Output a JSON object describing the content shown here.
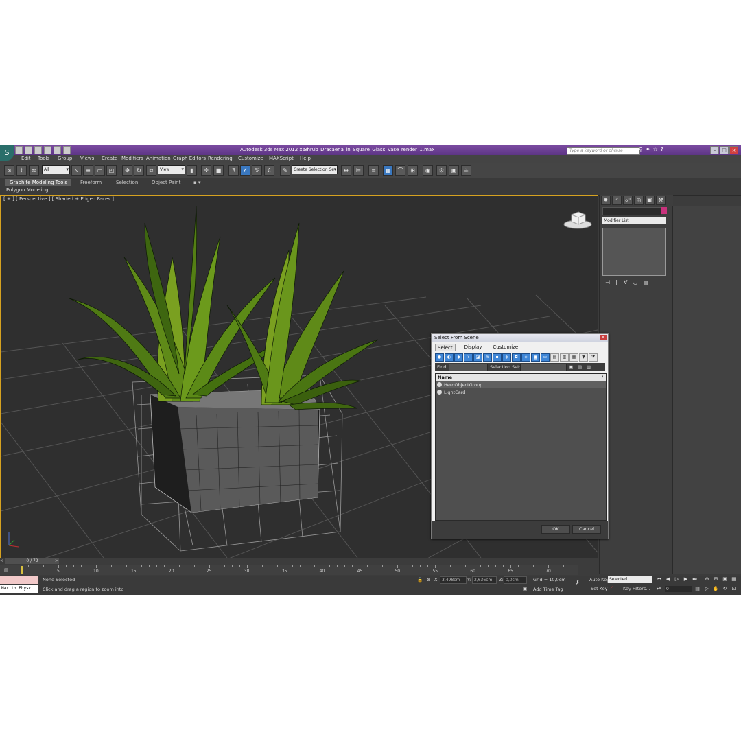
{
  "window": {
    "app_title": "Autodesk 3ds Max  2012 x64",
    "file_title": "Shrub_Dracaena_in_Square_Glass_Vase_render_1.max",
    "search_placeholder": "Type a keyword or phrase"
  },
  "menu": [
    "Edit",
    "Tools",
    "Group",
    "Views",
    "Create",
    "Modifiers",
    "Animation",
    "Graph Editors",
    "Rendering",
    "Customize",
    "MAXScript",
    "Help"
  ],
  "toolbar": {
    "selection_filter": "All",
    "ref_coord": "View",
    "named_selection": "Create Selection Se"
  },
  "ribbon": {
    "tabs": [
      "Graphite Modeling Tools",
      "Freeform",
      "Selection",
      "Object Paint"
    ],
    "sub": "Polygon Modeling"
  },
  "viewport": {
    "label": "[ + ] [ Perspective ] [ Shaded + Edged Faces ]"
  },
  "command_panel": {
    "modifier_list": "Modifier List",
    "colors": {
      "object_color": "#c8327c"
    }
  },
  "dialog": {
    "title": "Select From Scene",
    "menu": [
      "Select",
      "Display",
      "Customize"
    ],
    "find_label": "Find:",
    "selection_set_label": "Selection Set:",
    "column_name": "Name",
    "column_sort": "/",
    "rows": [
      "HeroObjectGroup",
      "LightCard"
    ],
    "ok": "OK",
    "cancel": "Cancel"
  },
  "timeline": {
    "frame": "0 / 72",
    "ticks": [
      "5",
      "10",
      "15",
      "20",
      "25",
      "30",
      "35",
      "40",
      "45",
      "50",
      "55",
      "60",
      "65",
      "70"
    ]
  },
  "status": {
    "maxscript_line1": "",
    "maxscript_line2": "Max to Physc.",
    "selection": "None Selected",
    "prompt": "Click and drag a region to zoom into",
    "x_label": "X:",
    "x_value": "3,498cm",
    "y_label": "Y:",
    "y_value": "2,636cm",
    "z_label": "Z:",
    "z_value": "0,0cm",
    "grid": "Grid = 10,0cm",
    "add_time_tag": "Add Time Tag",
    "auto_key": "Auto Key",
    "set_key": "Set Key",
    "key_mode": "Selected",
    "key_filters": "Key Filters...",
    "frame_field": "0"
  }
}
